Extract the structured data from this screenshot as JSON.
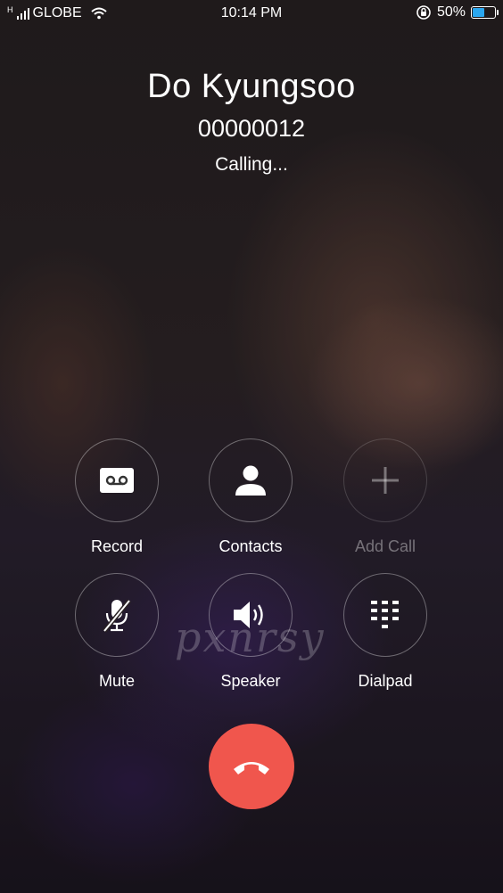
{
  "status_bar": {
    "network": "H",
    "carrier": "GLOBE",
    "time": "10:14 PM",
    "battery_percent": "50%",
    "battery_level": 0.5,
    "icons": [
      "signal-icon",
      "wifi-icon",
      "rotation-lock-icon",
      "battery-icon"
    ]
  },
  "caller": {
    "name": "Do Kyungsoo",
    "number": "00000012",
    "status": "Calling..."
  },
  "controls": [
    {
      "label": "Record",
      "icon": "cassette-icon",
      "enabled": true
    },
    {
      "label": "Contacts",
      "icon": "person-icon",
      "enabled": true
    },
    {
      "label": "Add Call",
      "icon": "plus-icon",
      "enabled": false
    },
    {
      "label": "Mute",
      "icon": "microphone-off-icon",
      "enabled": true
    },
    {
      "label": "Speaker",
      "icon": "speaker-icon",
      "enabled": true
    },
    {
      "label": "Dialpad",
      "icon": "dialpad-icon",
      "enabled": true
    }
  ],
  "end_call": {
    "icon": "phone-hangup-icon",
    "color": "#f0564d"
  },
  "watermark": "pxnrsy"
}
